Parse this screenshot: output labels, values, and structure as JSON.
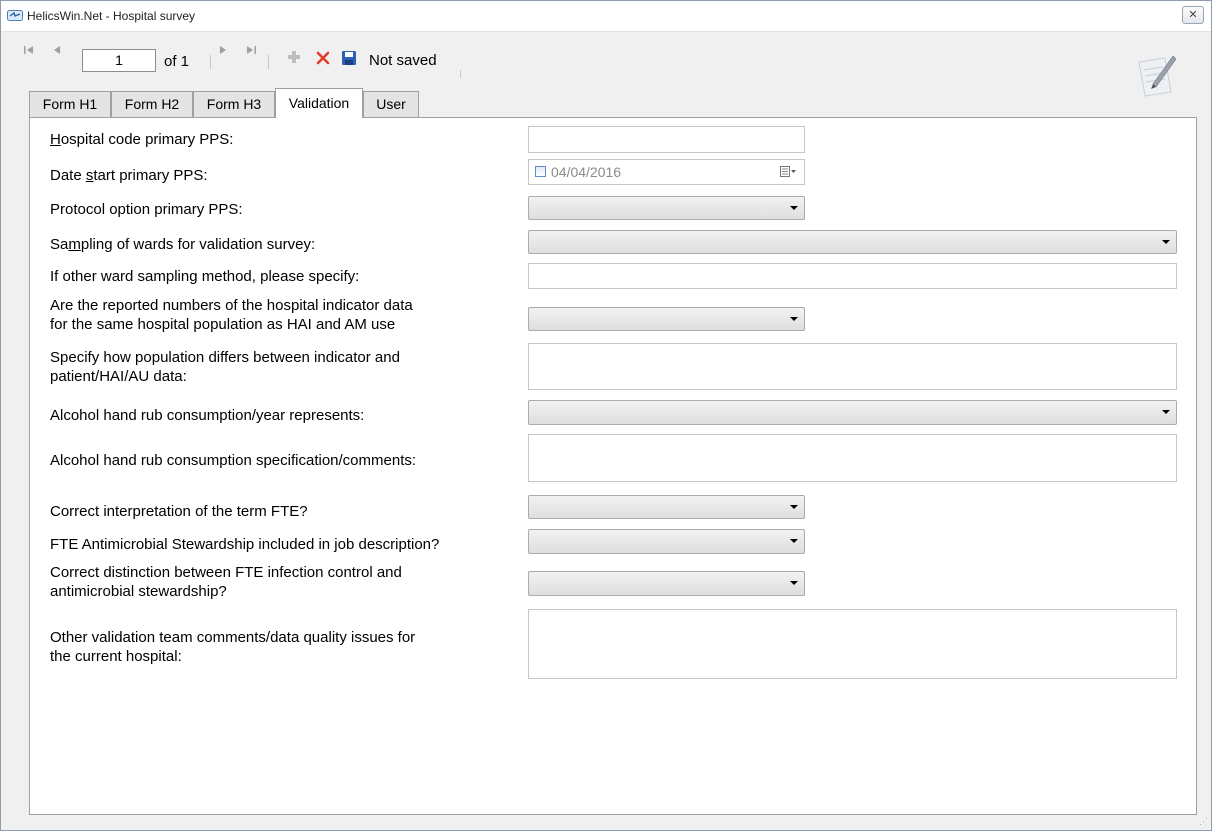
{
  "window": {
    "title": "HelicsWin.Net - Hospital survey",
    "close_label": "✕"
  },
  "toolbar": {
    "first_icon": "first-record-icon",
    "prev_icon": "previous-record-icon",
    "record_number": "1",
    "of_label": "of 1",
    "next_icon": "next-record-icon",
    "last_icon": "last-record-icon",
    "add_icon": "add-icon",
    "delete_icon": "delete-icon",
    "save_icon": "save-icon",
    "status": "Not saved"
  },
  "tabs": [
    {
      "label": "Form H1",
      "active": false
    },
    {
      "label": "Form H2",
      "active": false
    },
    {
      "label": "Form H3",
      "active": false
    },
    {
      "label": "Validation",
      "active": true
    },
    {
      "label": "User",
      "active": false
    }
  ],
  "form": {
    "hospital_code": {
      "label_pre": "",
      "label_u": "H",
      "label_post": "ospital code primary PPS:",
      "value": ""
    },
    "date_start": {
      "label_pre": "Date ",
      "label_u": "s",
      "label_post": "tart primary PPS:",
      "value": "04/04/2016",
      "checked": false
    },
    "protocol_option": {
      "label": "Protocol option primary PPS:",
      "value": ""
    },
    "sampling_wards": {
      "label_pre": "Sa",
      "label_u": "m",
      "label_post": "pling of wards for validation survey:",
      "value": ""
    },
    "other_sampling": {
      "label": "If other ward sampling method, please specify:",
      "value": ""
    },
    "same_population": {
      "label_line1": "Are the reported numbers of the hospital indicator data",
      "label_line2": "for the same hospital population as HAI and AM use",
      "value": ""
    },
    "population_differs": {
      "label_line1": "Specify how population differs between indicator and",
      "label_line2": "patient/HAI/AU data:",
      "value": ""
    },
    "alcohol_represents": {
      "label": "Alcohol hand rub consumption/year represents:",
      "value": ""
    },
    "alcohol_comments": {
      "label": "Alcohol hand rub consumption specification/comments:",
      "value": ""
    },
    "fte_interpretation": {
      "label": "Correct interpretation of the term FTE?",
      "value": ""
    },
    "fte_stewardship": {
      "label": "FTE Antimicrobial Stewardship included in job description?",
      "value": ""
    },
    "fte_distinction": {
      "label_line1": "Correct distinction between FTE infection control and",
      "label_line2": "antimicrobial stewardship?",
      "value": ""
    },
    "other_comments": {
      "label_line1": "Other validation team comments/data quality issues for",
      "label_line2": "the current hospital:",
      "value": ""
    }
  }
}
